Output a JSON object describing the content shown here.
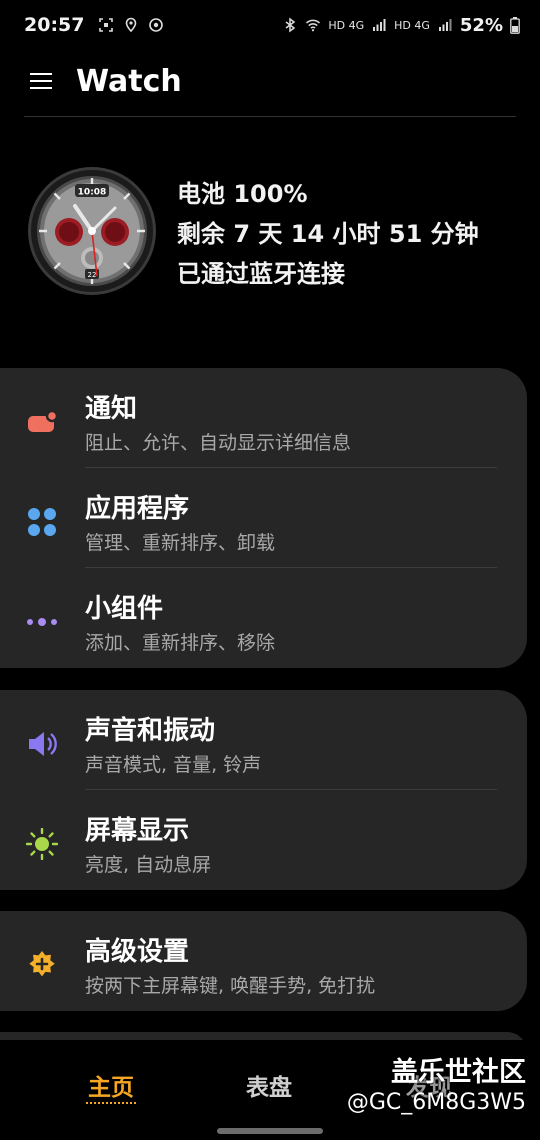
{
  "status_bar": {
    "time": "20:57",
    "battery": "52%",
    "network1": "HD 4G",
    "network2": "HD 4G",
    "left_icons": [
      "screenshot-icon",
      "location-icon",
      "sync-icon"
    ],
    "right_icons": [
      "bluetooth-icon",
      "wifi-icon",
      "signal-icon",
      "signal-icon",
      "battery-icon"
    ]
  },
  "app_bar": {
    "title": "Watch"
  },
  "watch": {
    "face_time": "10:08",
    "face_date": "22",
    "battery_line": "电池 100%",
    "remaining_line": "剩余 7 天 14 小时 51 分钟",
    "connection_line": "已通过蓝牙连接"
  },
  "cards": [
    {
      "rows": [
        {
          "title": "通知",
          "subtitle": "阻止、允许、自动显示详细信息",
          "icon": "notification-icon",
          "color": "#f07060"
        },
        {
          "title": "应用程序",
          "subtitle": "管理、重新排序、卸载",
          "icon": "apps-icon",
          "color": "#5aa7f0"
        },
        {
          "title": "小组件",
          "subtitle": "添加、重新排序、移除",
          "icon": "widgets-icon",
          "color": "#a98cf0"
        }
      ]
    },
    {
      "rows": [
        {
          "title": "声音和振动",
          "subtitle": "声音模式, 音量, 铃声",
          "icon": "sound-icon",
          "color": "#8a78f0"
        },
        {
          "title": "屏幕显示",
          "subtitle": "亮度, 自动息屏",
          "icon": "display-icon",
          "color": "#a8d84a"
        }
      ]
    },
    {
      "rows": [
        {
          "title": "高级设置",
          "subtitle": "按两下主屏幕键, 唤醒手势, 免打扰",
          "icon": "advanced-settings-icon",
          "color": "#f5b02a"
        }
      ]
    }
  ],
  "bottom_nav": {
    "tabs": [
      "主页",
      "表盘",
      "发现"
    ],
    "active": "主页",
    "active_color": "#f5a623"
  },
  "watermark": {
    "title": "盖乐世社区",
    "subtitle": "@GC_6M8G3W5"
  }
}
